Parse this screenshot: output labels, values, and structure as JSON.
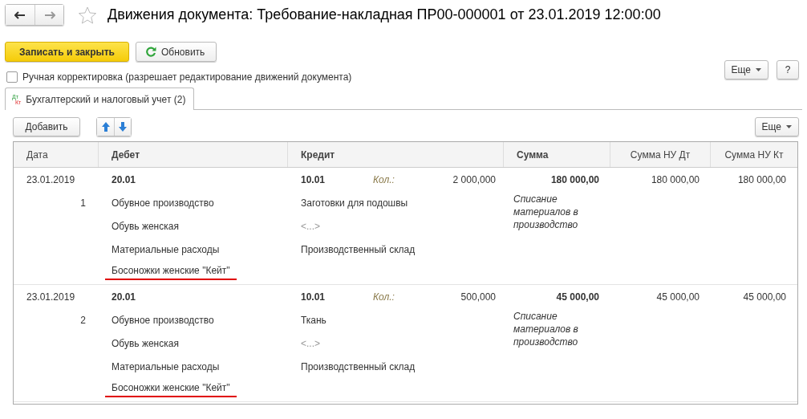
{
  "window": {
    "title": "Движения документа: Требование-накладная ПР00-000001 от 23.01.2019 12:00:00",
    "favorite": false
  },
  "toolbar": {
    "save": "Записать и закрыть",
    "refresh": "Обновить",
    "more": "Еще",
    "help": "?"
  },
  "manual_edit": {
    "label": "Ручная корректировка (разрешает редактирование движений документа)",
    "checked": false
  },
  "tabs": [
    {
      "label": "Бухгалтерский и налоговый учет (2)",
      "icon_top": "Дт",
      "icon_bottom": "Кт",
      "selected": true
    }
  ],
  "table_toolbar": {
    "add": "Добавить",
    "more": "Еще"
  },
  "table": {
    "columns": [
      {
        "label": "Дата",
        "bold": false
      },
      {
        "label": "Дебет",
        "bold": true
      },
      {
        "label": "Кредит",
        "bold": true
      },
      {
        "label": "Сумма",
        "bold": true
      },
      {
        "label": "Сумма НУ Дт",
        "bold": false
      },
      {
        "label": "Сумма НУ Кт",
        "bold": false
      }
    ],
    "rows": [
      {
        "date": "23.01.2019",
        "number": "1",
        "debit_account": "20.01",
        "debit_lines": [
          {
            "text": "Обувное производство",
            "underlined": false
          },
          {
            "text": "Обувь женская",
            "underlined": false
          },
          {
            "text": "Материальные расходы",
            "underlined": false
          },
          {
            "text": "Босоножки женские \"Кейт\"",
            "underlined": true
          }
        ],
        "credit_account": "10.01",
        "qty_label": "Кол.:",
        "qty": "2 000,000",
        "credit_lines": [
          {
            "text": "Заготовки для подошвы",
            "empty": false
          },
          {
            "text": "<...>",
            "empty": true
          },
          {
            "text": "Производственный склад",
            "empty": false
          }
        ],
        "amount": "180 000,00",
        "content": "Списание материалов в производство",
        "tax_dt": "180 000,00",
        "tax_kt": "180 000,00"
      },
      {
        "date": "23.01.2019",
        "number": "2",
        "debit_account": "20.01",
        "debit_lines": [
          {
            "text": "Обувное производство",
            "underlined": false
          },
          {
            "text": "Обувь женская",
            "underlined": false
          },
          {
            "text": "Материальные расходы",
            "underlined": false
          },
          {
            "text": "Босоножки женские \"Кейт\"",
            "underlined": true
          }
        ],
        "credit_account": "10.01",
        "qty_label": "Кол.:",
        "qty": "500,000",
        "credit_lines": [
          {
            "text": "Ткань",
            "empty": false
          },
          {
            "text": "<...>",
            "empty": true
          },
          {
            "text": "Производственный склад",
            "empty": false
          }
        ],
        "amount": "45 000,00",
        "content": "Списание материалов в производство",
        "tax_dt": "45 000,00",
        "tax_kt": "45 000,00"
      }
    ]
  }
}
